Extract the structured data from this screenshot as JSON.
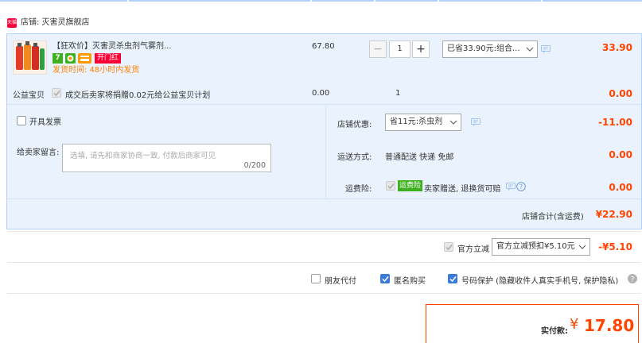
{
  "shop": {
    "icon_text": "天猫",
    "label": "店铺: 灭害灵旗舰店"
  },
  "item": {
    "title": "【狂欢价】灭害灵杀虫剂气雾剂...",
    "red_tag": "开门红",
    "ship_time": "发货时间: 48小时内发货",
    "price": "67.80",
    "quantity": "1",
    "discount_select": "已省33.90元:组合...",
    "subtotal": "33.90",
    "img_text": "灭害灵"
  },
  "charity": {
    "label": "公益宝贝",
    "text": "成交后卖家将捐赠0.02元给公益宝贝计划",
    "price": "0.00",
    "qty": "1",
    "amount": "0.00"
  },
  "invoice": {
    "label": "开具发票"
  },
  "store_coupon": {
    "label": "店铺优惠:",
    "select": "省11元:杀虫剂",
    "amount": "-11.00"
  },
  "message": {
    "label": "给卖家留言:",
    "placeholder": "选填, 请先和商家协商一致, 付款后商家可见",
    "counter": "0/200"
  },
  "shipping": {
    "label": "运送方式:",
    "text": "普通配送 快递 免邮",
    "amount": "0.00"
  },
  "insurance": {
    "label": "运费险:",
    "badge": "运费险",
    "text": "卖家赠送, 退换货可赔",
    "amount": "0.00"
  },
  "store_total": {
    "label": "店铺合计(含运费)",
    "amount": "¥22.90"
  },
  "official": {
    "label": "官方立减",
    "select": "官方立减预扣¥5.10元",
    "amount": "-¥5.10"
  },
  "options": {
    "friend_pay": "朋友代付",
    "anonymous": "匿名购买",
    "phone_protect": "号码保护 (隐藏收件人真实手机号, 保护隐私)"
  },
  "pay": {
    "label": "实付款:",
    "currency": "¥",
    "amount": "17.80"
  },
  "colors": {
    "accent": "#ff4400",
    "blue_bg": "#eaf3fd",
    "blue_border": "#b2d1ff"
  }
}
